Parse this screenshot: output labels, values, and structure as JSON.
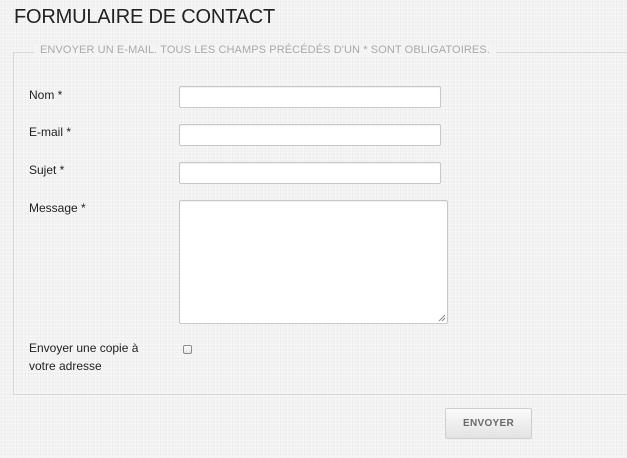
{
  "page": {
    "title": "FORMULAIRE DE CONTACT"
  },
  "form": {
    "legend": "ENVOYER UN E-MAIL. TOUS LES CHAMPS PRÉCÉDÉS D'UN * SONT OBLIGATOIRES.",
    "fields": {
      "name": {
        "label": "Nom *",
        "value": ""
      },
      "email": {
        "label": "E-mail *",
        "value": ""
      },
      "subject": {
        "label": "Sujet *",
        "value": ""
      },
      "message": {
        "label": "Message *",
        "value": ""
      }
    },
    "copy_checkbox": {
      "label_line1": "Envoyer une copie à",
      "label_line2": "votre adresse",
      "checked": false
    },
    "submit_label": "ENVOYER"
  }
}
